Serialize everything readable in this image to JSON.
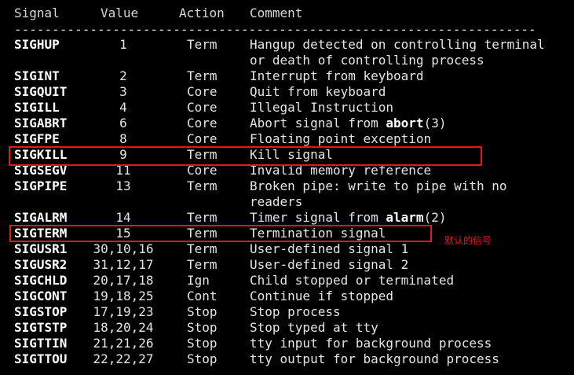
{
  "headers": {
    "signal": "Signal",
    "value": "Value",
    "action": "Action",
    "comment": "Comment"
  },
  "separator": "---------------------------------------------------------------------",
  "rows": [
    {
      "name": "SIGHUP",
      "value": "1",
      "action": "Term",
      "comment": "Hangup detected on controlling terminal",
      "comment2": "or death of controlling process"
    },
    {
      "name": "SIGINT",
      "value": "2",
      "action": "Term",
      "comment": "Interrupt from keyboard"
    },
    {
      "name": "SIGQUIT",
      "value": "3",
      "action": "Core",
      "comment": "Quit from keyboard"
    },
    {
      "name": "SIGILL",
      "value": "4",
      "action": "Core",
      "comment": "Illegal Instruction"
    },
    {
      "name": "SIGABRT",
      "value": "6",
      "action": "Core",
      "comment_pre": "Abort signal from ",
      "comment_bold": "abort",
      "comment_post": "(3)"
    },
    {
      "name": "SIGFPE",
      "value": "8",
      "action": "Core",
      "comment": "Floating point exception"
    },
    {
      "name": "SIGKILL",
      "value": "9",
      "action": "Term",
      "comment": "Kill signal"
    },
    {
      "name": "SIGSEGV",
      "value": "11",
      "action": "Core",
      "comment": "Invalid memory reference"
    },
    {
      "name": "SIGPIPE",
      "value": "13",
      "action": "Term",
      "comment": "Broken pipe: write to pipe with no",
      "comment2": "readers"
    },
    {
      "name": "SIGALRM",
      "value": "14",
      "action": "Term",
      "comment_pre": "Timer signal from ",
      "comment_bold": "alarm",
      "comment_post": "(2)"
    },
    {
      "name": "SIGTERM",
      "value": "15",
      "action": "Term",
      "comment": "Termination signal"
    },
    {
      "name": "SIGUSR1",
      "value": "30,10,16",
      "action": "Term",
      "comment": "User-defined signal 1"
    },
    {
      "name": "SIGUSR2",
      "value": "31,12,17",
      "action": "Term",
      "comment": "User-defined signal 2"
    },
    {
      "name": "SIGCHLD",
      "value": "20,17,18",
      "action": "Ign",
      "comment": "Child stopped or terminated"
    },
    {
      "name": "SIGCONT",
      "value": "19,18,25",
      "action": "Cont",
      "comment": "Continue if stopped"
    },
    {
      "name": "SIGSTOP",
      "value": "17,19,23",
      "action": "Stop",
      "comment": "Stop process"
    },
    {
      "name": "SIGTSTP",
      "value": "18,20,24",
      "action": "Stop",
      "comment": "Stop typed at tty"
    },
    {
      "name": "SIGTTIN",
      "value": "21,21,26",
      "action": "Stop",
      "comment": "tty input for background process"
    },
    {
      "name": "SIGTTOU",
      "value": "22,22,27",
      "action": "Stop",
      "comment": "tty output for background process"
    }
  ],
  "annotation": {
    "note": "默认的信号",
    "color": "#e8141e"
  },
  "colors": {
    "background": "#000000",
    "text": "#e5e5e5",
    "highlight": "#e8141e"
  }
}
